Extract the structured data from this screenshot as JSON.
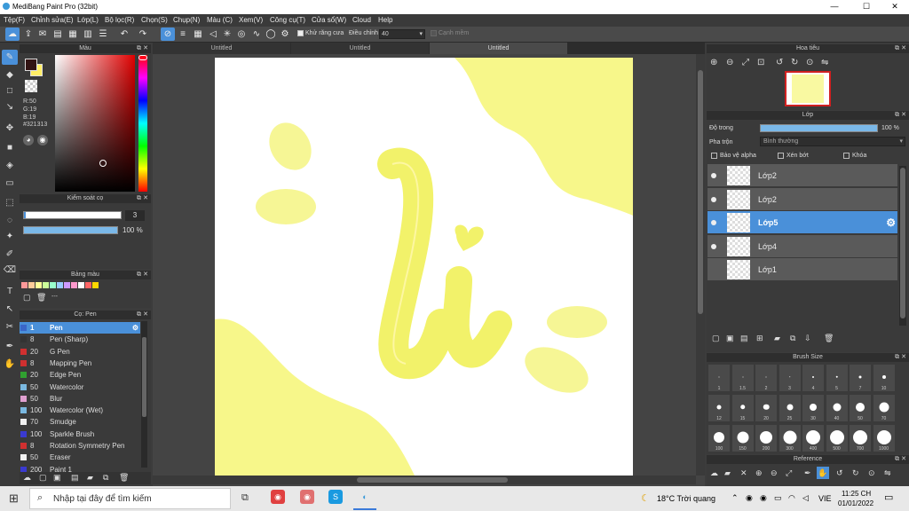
{
  "window": {
    "title": "MediBang Paint Pro (32bit)",
    "min": "—",
    "max": "☐",
    "close": "✕"
  },
  "menu": [
    "Tệp(F)",
    "Chỉnh sửa(E)",
    "Lớp(L)",
    "Bộ lọc(R)",
    "Chọn(S)",
    "Chụp(N)",
    "Màu (C)",
    "Xem(V)",
    "Công cụ(T)",
    "Cửa sổ(W)",
    "Cloud",
    "Help"
  ],
  "toolbar": {
    "antialias": "Khử răng cưa",
    "adjust_label": "Điều chỉnh",
    "adjust_value": "40",
    "soft": "Cạnh mềm"
  },
  "tabs": [
    "Untitled",
    "Untitled",
    "Untitled"
  ],
  "color_panel": {
    "title": "Màu",
    "r": "R:50",
    "g": "G:19",
    "b": "B:19",
    "hex": "#321313",
    "fg": "#321313"
  },
  "brush_control": {
    "title": "Kiểm soát cọ",
    "size": "3",
    "opacity": "100 %"
  },
  "palette": {
    "title": "Bảng màu",
    "more": "---",
    "colors": [
      "#ff9999",
      "#ffcc99",
      "#ffff99",
      "#ccff99",
      "#99ffcc",
      "#99ccff",
      "#cc99ff",
      "#ff99cc",
      "#ffffff",
      "#ff6666",
      "#ffd700"
    ]
  },
  "brush_panel": {
    "title": "Cọ: Pen",
    "items": [
      {
        "size": "1",
        "name": "Pen",
        "color": "#3a66c8"
      },
      {
        "size": "8",
        "name": "Pen (Sharp)",
        "color": "#333333"
      },
      {
        "size": "20",
        "name": "G Pen",
        "color": "#d03030"
      },
      {
        "size": "8",
        "name": "Mapping Pen",
        "color": "#d03030"
      },
      {
        "size": "20",
        "name": "Edge Pen",
        "color": "#30a030"
      },
      {
        "size": "50",
        "name": "Watercolor",
        "color": "#7ab8e0"
      },
      {
        "size": "50",
        "name": "Blur",
        "color": "#e0a0d0"
      },
      {
        "size": "100",
        "name": "Watercolor (Wet)",
        "color": "#7ab8e0"
      },
      {
        "size": "70",
        "name": "Smudge",
        "color": "#f0f0f0"
      },
      {
        "size": "100",
        "name": "Sparkle Brush",
        "color": "#3a3ad0"
      },
      {
        "size": "8",
        "name": "Rotation Symmetry Pen",
        "color": "#d03030"
      },
      {
        "size": "50",
        "name": "Eraser",
        "color": "#f0f0f0"
      },
      {
        "size": "200",
        "name": "Paint 1",
        "color": "#3a3ad0"
      }
    ]
  },
  "navigator": {
    "title": "Hoa tiêu"
  },
  "layer_panel": {
    "title": "Lớp",
    "opacity_label": "Độ trong",
    "opacity_value": "100 %",
    "blend_label": "Pha trộn",
    "blend_value": "Bình thường",
    "protect_alpha": "Bảo vệ alpha",
    "clip": "Xén bớt",
    "lock": "Khóa",
    "layers": [
      "Lớp2",
      "Lớp2",
      "Lớp5",
      "Lớp4",
      "Lớp1"
    ]
  },
  "brush_size": {
    "title": "Brush Size",
    "sizes": [
      "1",
      "1.5",
      "2",
      "3",
      "4",
      "5",
      "7",
      "10",
      "12",
      "15",
      "20",
      "25",
      "30",
      "40",
      "50",
      "70",
      "100",
      "150",
      "200",
      "300",
      "400",
      "500",
      "700",
      "1000"
    ]
  },
  "reference": {
    "title": "Reference"
  },
  "taskbar": {
    "search": "Nhập tại đây để tìm kiếm",
    "weather": "18°C Trời quang",
    "lang": "VIE",
    "time": "11:25 CH",
    "date": "01/01/2022"
  }
}
